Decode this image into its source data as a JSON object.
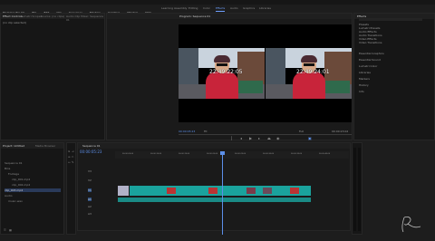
{
  "menubar": {
    "items": [
      "Premiere Pro CC",
      "File",
      "Edit",
      "Clip",
      "Sequence",
      "Markers",
      "Graphics",
      "Window",
      "Help"
    ]
  },
  "workspaces": {
    "items": [
      "Learning",
      "Assembly",
      "Editing",
      "Color",
      "Effects",
      "Audio",
      "Graphics",
      "Libraries"
    ],
    "active": "Effects"
  },
  "source_panel": {
    "tabs": [
      "Effect Controls",
      "Lumetri Scopes",
      "Source: (no clips)",
      "Audio Clip Mixer: Sequence 01"
    ],
    "no_clip_text": "(no clip selected)"
  },
  "program_monitor": {
    "tab": "Program: Sequence 01",
    "timecode_left": "00:00:05:23",
    "timecode_right": "00:00:23:02",
    "fit": "Fit",
    "quality": "Full",
    "overlay_left": "22:49:22:05",
    "overlay_right": "22:49:24:01"
  },
  "effects_panel": {
    "tab": "Effects",
    "items": [
      "Presets",
      "Lumetri Presets",
      "Audio Effects",
      "Audio Transitions",
      "Video Effects",
      "Video Transitions"
    ],
    "sections": [
      "Essential Graphics",
      "Essential Sound",
      "Lumetri Color",
      "Libraries",
      "Markers",
      "History",
      "Info"
    ]
  },
  "project_panel": {
    "tabs": [
      "Project: Untitled",
      "Media Browser"
    ],
    "items": [
      "Sequence 01",
      "Bins",
      "Footage",
      "clip_001.mp4",
      "clip_002.mp4",
      "clip_003.mp4",
      "Audio",
      "music.wav"
    ]
  },
  "timeline": {
    "tab": "Sequence 01",
    "timecode": "00:00:05:23",
    "tracks": [
      "V3",
      "V2",
      "V1",
      "A1",
      "A2",
      "A3"
    ],
    "ruler": [
      "00:00:05:00",
      "00:00:10:00",
      "00:00:15:00",
      "00:00:20:00",
      "00:00:25:00",
      "00:00:30:00",
      "00:00:35:00",
      "00:00:40:00"
    ]
  },
  "colors": {
    "accent": "#5c8fe8",
    "clip": "#1aa39d",
    "person": "#c8243a"
  }
}
